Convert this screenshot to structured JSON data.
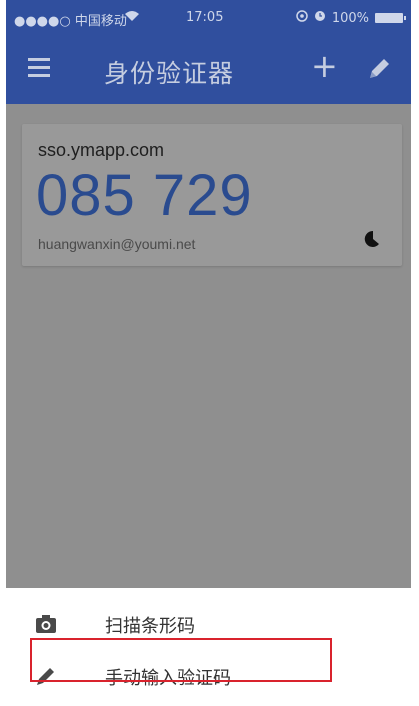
{
  "status_bar": {
    "carrier": "●●●●○ 中国移动",
    "wifi_icon": "wifi-icon",
    "time": "17:05",
    "battery_percent": "100%"
  },
  "app_bar": {
    "title": "身份验证器",
    "menu_icon": "menu-icon",
    "add_icon": "plus-icon",
    "edit_icon": "pencil-icon"
  },
  "account_card": {
    "site": "sso.ymapp.com",
    "code": "085 729",
    "account": "huangwanxin@youmi.net",
    "timer_icon": "countdown-timer-icon"
  },
  "bottom_sheet": {
    "items": [
      {
        "icon": "camera-icon",
        "label": "扫描条形码"
      },
      {
        "icon": "pencil-icon",
        "label": "手动输入验证码"
      }
    ]
  },
  "colors": {
    "app_bar": "#304f9e",
    "code_text": "#2a4b8f",
    "highlight_border": "#d9232d",
    "overlay_background": "#8f8f8f"
  }
}
